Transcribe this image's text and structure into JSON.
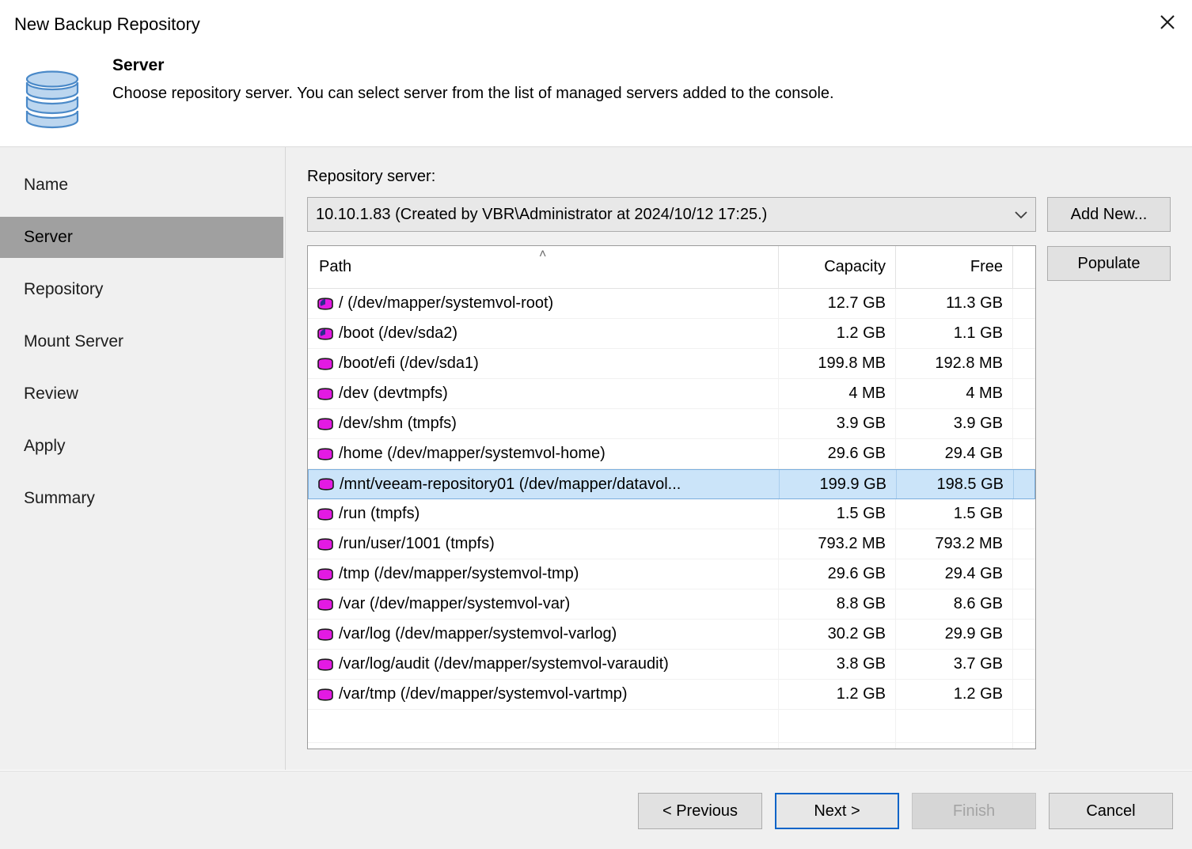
{
  "window": {
    "title": "New Backup Repository",
    "close_icon": "close-icon"
  },
  "header": {
    "icon": "database-stack-icon",
    "title": "Server",
    "description": "Choose repository server. You can select server from the list of managed servers added to the console."
  },
  "sidebar": {
    "items": [
      {
        "label": "Name",
        "selected": false
      },
      {
        "label": "Server",
        "selected": true
      },
      {
        "label": "Repository",
        "selected": false
      },
      {
        "label": "Mount Server",
        "selected": false
      },
      {
        "label": "Review",
        "selected": false
      },
      {
        "label": "Apply",
        "selected": false
      },
      {
        "label": "Summary",
        "selected": false
      }
    ]
  },
  "main": {
    "repository_server_label": "Repository server:",
    "server_select": {
      "value": "10.10.1.83 (Created by VBR\\Administrator at 2024/10/12 17:25.)",
      "arrow_icon": "chevron-down-icon"
    },
    "add_new_label": "Add New...",
    "populate_label": "Populate",
    "table": {
      "sort_indicator": "˄",
      "columns": [
        "Path",
        "Capacity",
        "Free"
      ],
      "rows": [
        {
          "path": "/ (/dev/mapper/systemvol-root)",
          "capacity": "12.7 GB",
          "free": "11.3 GB",
          "icon": "system-volume-icon",
          "selected": false
        },
        {
          "path": "/boot (/dev/sda2)",
          "capacity": "1.2 GB",
          "free": "1.1 GB",
          "icon": "system-volume-icon",
          "selected": false
        },
        {
          "path": "/boot/efi (/dev/sda1)",
          "capacity": "199.8 MB",
          "free": "192.8 MB",
          "icon": "volume-icon",
          "selected": false
        },
        {
          "path": "/dev (devtmpfs)",
          "capacity": "4 MB",
          "free": "4 MB",
          "icon": "volume-icon",
          "selected": false
        },
        {
          "path": "/dev/shm (tmpfs)",
          "capacity": "3.9 GB",
          "free": "3.9 GB",
          "icon": "volume-icon",
          "selected": false
        },
        {
          "path": "/home (/dev/mapper/systemvol-home)",
          "capacity": "29.6 GB",
          "free": "29.4 GB",
          "icon": "volume-icon",
          "selected": false
        },
        {
          "path": "/mnt/veeam-repository01 (/dev/mapper/datavol...",
          "capacity": "199.9 GB",
          "free": "198.5 GB",
          "icon": "volume-icon",
          "selected": true
        },
        {
          "path": "/run (tmpfs)",
          "capacity": "1.5 GB",
          "free": "1.5 GB",
          "icon": "volume-icon",
          "selected": false
        },
        {
          "path": "/run/user/1001 (tmpfs)",
          "capacity": "793.2 MB",
          "free": "793.2 MB",
          "icon": "volume-icon",
          "selected": false
        },
        {
          "path": "/tmp (/dev/mapper/systemvol-tmp)",
          "capacity": "29.6 GB",
          "free": "29.4 GB",
          "icon": "volume-icon",
          "selected": false
        },
        {
          "path": "/var (/dev/mapper/systemvol-var)",
          "capacity": "8.8 GB",
          "free": "8.6 GB",
          "icon": "volume-icon",
          "selected": false
        },
        {
          "path": "/var/log (/dev/mapper/systemvol-varlog)",
          "capacity": "30.2 GB",
          "free": "29.9 GB",
          "icon": "volume-icon",
          "selected": false
        },
        {
          "path": "/var/log/audit (/dev/mapper/systemvol-varaudit)",
          "capacity": "3.8 GB",
          "free": "3.7 GB",
          "icon": "volume-icon",
          "selected": false
        },
        {
          "path": "/var/tmp (/dev/mapper/systemvol-vartmp)",
          "capacity": "1.2 GB",
          "free": "1.2 GB",
          "icon": "volume-icon",
          "selected": false
        }
      ],
      "empty_rows": 2
    }
  },
  "footer": {
    "previous_label": "< Previous",
    "next_label": "Next >",
    "finish_label": "Finish",
    "cancel_label": "Cancel"
  },
  "colors": {
    "selection_blue": "#cbe4f9",
    "selection_border": "#7aaede",
    "focus_blue": "#0a64c8",
    "sidebar_selected": "#a0a0a0",
    "disk_magenta": "#e31ae3",
    "disk_system_blue": "#2b2b8f",
    "window_bg": "#f0f0f0"
  }
}
